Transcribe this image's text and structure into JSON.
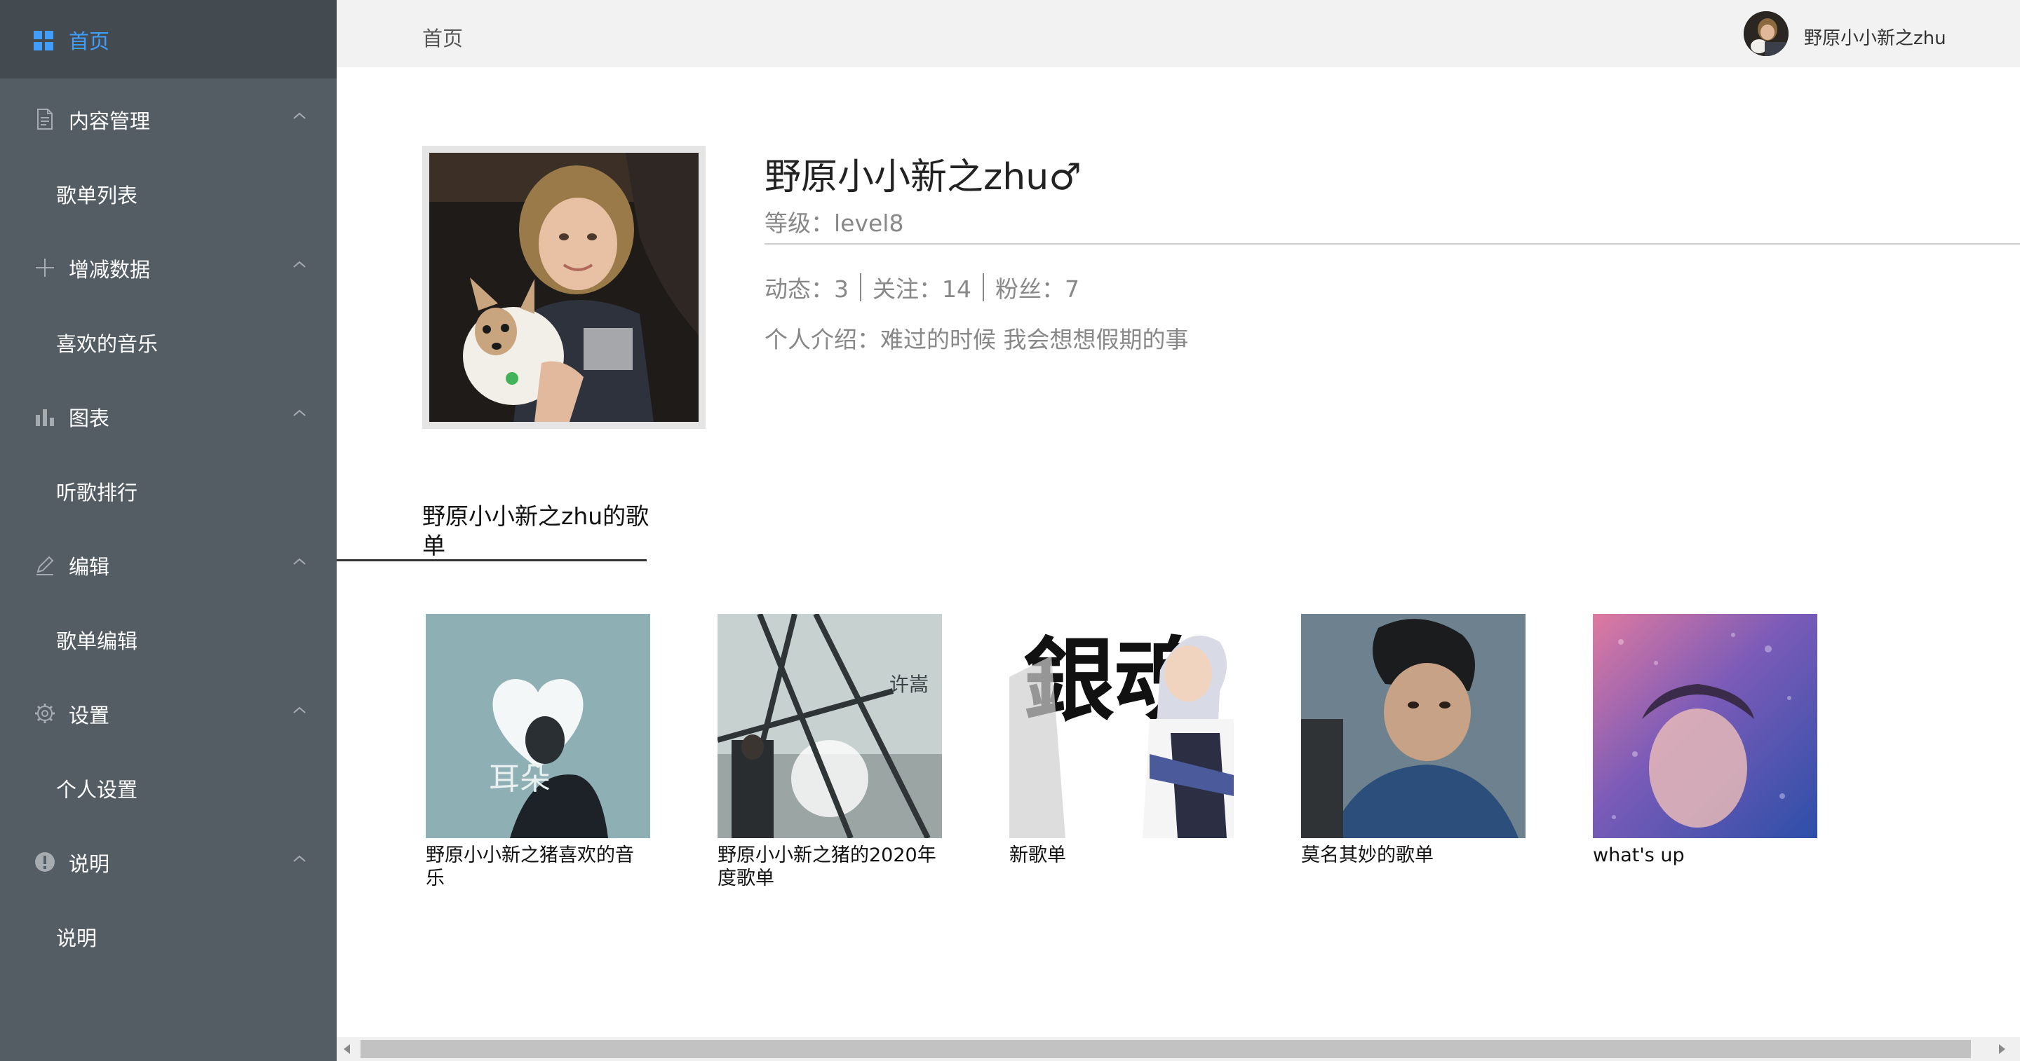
{
  "sidebar": {
    "home_label": "首页",
    "groups": [
      {
        "label": "内容管理",
        "icon": "document-icon",
        "item": "歌单列表"
      },
      {
        "label": "增减数据",
        "icon": "plus-icon",
        "item": "喜欢的音乐"
      },
      {
        "label": "图表",
        "icon": "bar-chart-icon",
        "item": "听歌排行"
      },
      {
        "label": "编辑",
        "icon": "edit-icon",
        "item": "歌单编辑"
      },
      {
        "label": "设置",
        "icon": "gear-icon",
        "item": "个人设置"
      },
      {
        "label": "说明",
        "icon": "info-icon",
        "item": "说明"
      }
    ]
  },
  "topbar": {
    "breadcrumb": "首页",
    "username": "野原小小新之zhu"
  },
  "profile": {
    "name": "野原小小新之zhu♂",
    "level": "等级：level8",
    "stats": [
      "动态：3",
      "关注：14",
      "粉丝：7"
    ],
    "intro": "个人介绍：难过的时候 我会想想假期的事"
  },
  "playlists": {
    "title": "野原小小新之zhu的歌单",
    "items": [
      {
        "caption": "野原小小新之猪喜欢的音乐",
        "cover_text": "耳朵"
      },
      {
        "caption": "野原小小新之猪的2020年度歌单",
        "cover_text": "许嵩"
      },
      {
        "caption": "新歌单",
        "cover_text": "銀魂"
      },
      {
        "caption": "莫名其妙的歌单"
      },
      {
        "caption": "what's up"
      }
    ]
  },
  "colors": {
    "sidebar_bg": "#545c64",
    "sidebar_active_bg": "#434a50",
    "accent": "#409eff",
    "topbar_bg": "#f2f2f2"
  }
}
